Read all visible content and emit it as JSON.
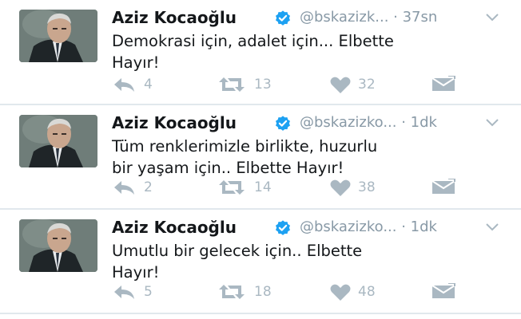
{
  "colors": {
    "icon": "#aab8c2",
    "name": "#14171a",
    "handle": "#8899a6",
    "verified": "#1da1f2",
    "divider": "#e1e8ed"
  },
  "tweets": [
    {
      "name": "Aziz Kocaoğlu",
      "handle_time": "@bskazizk... · 37sn",
      "text": "Demokrasi için, adalet için... Elbette\nHayır!",
      "replies": "4",
      "retweets": "13",
      "likes": "32"
    },
    {
      "name": "Aziz Kocaoğlu",
      "handle_time": "@bskazizko... · 1dk",
      "text": "Tüm renklerimizle birlikte, huzurlu\nbir yaşam için.. Elbette Hayır!",
      "replies": "2",
      "retweets": "14",
      "likes": "38"
    },
    {
      "name": "Aziz Kocaoğlu",
      "handle_time": "@bskazizko... · 1dk",
      "text": "Umutlu bir gelecek için..  Elbette\nHayır!",
      "replies": "5",
      "retweets": "18",
      "likes": "48"
    }
  ],
  "icons": {
    "avatar": "profile-photo",
    "verified": "verified-badge-icon",
    "menu": "chevron-down-icon",
    "reply": "reply-icon",
    "retweet": "retweet-icon",
    "like": "heart-icon",
    "dm": "envelope-icon"
  }
}
